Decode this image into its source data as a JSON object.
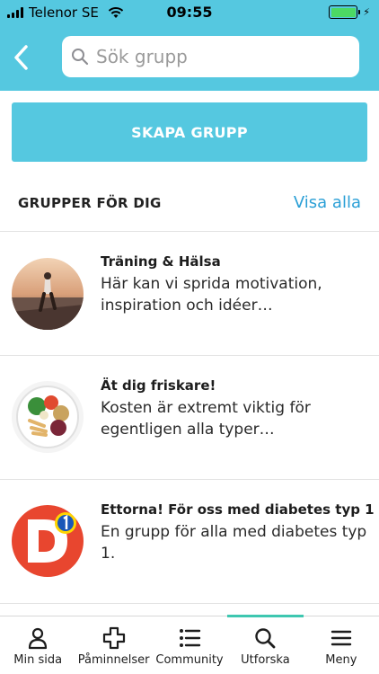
{
  "status_bar": {
    "carrier": "Telenor SE",
    "time": "09:55"
  },
  "search": {
    "placeholder": "Sök grupp"
  },
  "create_button": {
    "label": "SKAPA GRUPP"
  },
  "section": {
    "title": "GRUPPER FÖR DIG",
    "show_all": "Visa alla"
  },
  "groups": [
    {
      "title": "Träning & Hälsa",
      "description": "Här kan vi sprida motivation, inspiration och idéer…"
    },
    {
      "title": "Ät dig friskare!",
      "description": "Kosten är extremt viktig för egentligen alla typer…"
    },
    {
      "title": "Ettorna! För oss med diabetes typ 1",
      "description": "En grupp för alla med diabetes typ 1."
    }
  ],
  "tabs": [
    {
      "label": "Min sida",
      "icon": "person-icon"
    },
    {
      "label": "Påminnelser",
      "icon": "plus-icon"
    },
    {
      "label": "Community",
      "icon": "list-icon"
    },
    {
      "label": "Utforska",
      "icon": "search-icon",
      "active": true
    },
    {
      "label": "Meny",
      "icon": "menu-icon"
    }
  ],
  "colors": {
    "header": "#55c8e0",
    "accent": "#2a9fd6",
    "active_tab": "#3ec7b0"
  }
}
